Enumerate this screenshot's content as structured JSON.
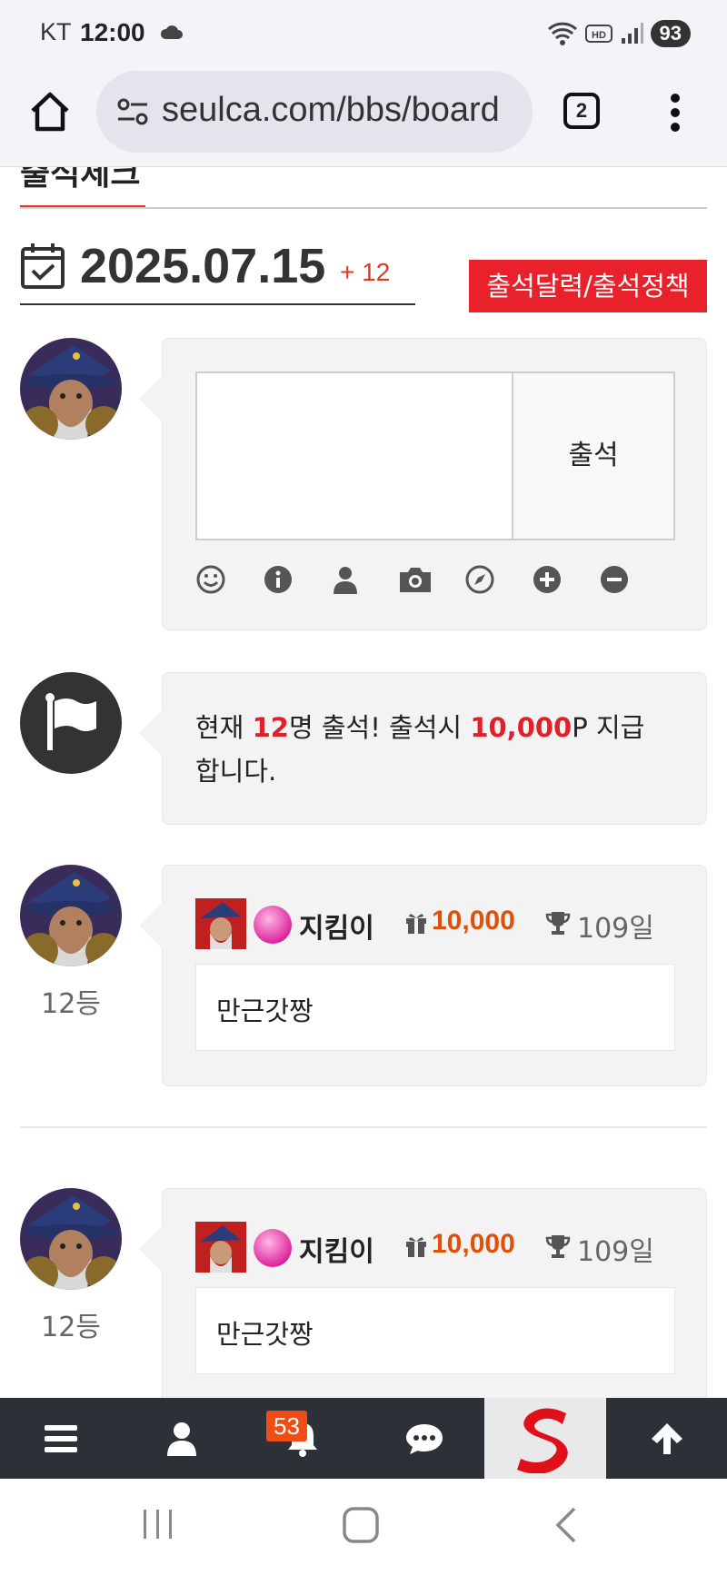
{
  "status_bar": {
    "carrier": "KT",
    "time": "12:00",
    "battery": "93"
  },
  "browser": {
    "url": "seulca.com/bbs/board",
    "tab_count": "2"
  },
  "page": {
    "title": "출석체크",
    "date": "2025.07.15",
    "date_count": "+ 12",
    "policy_button": "출석달력/출석정책"
  },
  "comment_form": {
    "submit_label": "출석",
    "toolbar": [
      "smile-icon",
      "info-icon",
      "user-icon",
      "camera-icon",
      "compass-icon",
      "plus-circle-icon",
      "minus-circle-icon"
    ]
  },
  "notice": {
    "prefix": "현재 ",
    "count": "12",
    "mid": "명 출석! 출석시 ",
    "points": "10,000",
    "suffix": "P 지급합니다."
  },
  "entries": [
    {
      "rank": "12등",
      "nickname": "지킴이",
      "points": "10,000",
      "days": "109일",
      "message": "만근갓짱"
    },
    {
      "rank": "12등",
      "nickname": "지킴이",
      "points": "10,000",
      "days": "109일",
      "message": "만근갓짱"
    }
  ],
  "bottom_nav": {
    "notification_count": "53",
    "items": [
      "menu-icon",
      "user-icon",
      "bell-icon",
      "chat-icon",
      "site-logo",
      "arrow-up-icon"
    ]
  },
  "colors": {
    "accent_red": "#e8212a",
    "point_orange": "#e0500a",
    "nav_bg": "#2b3137"
  }
}
